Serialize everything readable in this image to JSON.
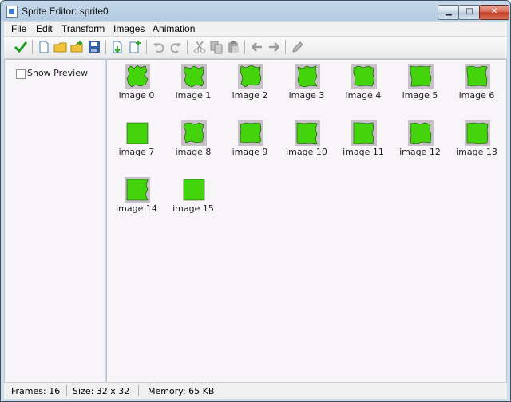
{
  "window": {
    "title": "Sprite Editor: sprite0",
    "controls": [
      "minimize-icon",
      "maximize-icon",
      "close-icon"
    ]
  },
  "menu": [
    {
      "accel": "F",
      "rest": "ile"
    },
    {
      "accel": "E",
      "rest": "dit"
    },
    {
      "accel": "T",
      "rest": "ransform"
    },
    {
      "accel": "I",
      "rest": "mages"
    },
    {
      "accel": "A",
      "rest": "nimation"
    }
  ],
  "toolbar": {
    "icons": [
      "confirm-check-icon",
      "new-file-icon",
      "open-folder-icon",
      "add-from-file-icon",
      "save-icon",
      "insert-image-icon",
      "add-image-icon",
      "undo-icon",
      "redo-icon",
      "cut-icon",
      "copy-icon",
      "paste-icon",
      "shift-left-icon",
      "shift-right-icon",
      "edit-pencil-icon"
    ]
  },
  "left": {
    "show_preview_label": "Show Preview",
    "show_preview_checked": false
  },
  "images": [
    {
      "label": "image 0"
    },
    {
      "label": "image 1"
    },
    {
      "label": "image 2"
    },
    {
      "label": "image 3"
    },
    {
      "label": "image 4"
    },
    {
      "label": "image 5"
    },
    {
      "label": "image 6"
    },
    {
      "label": "image 7"
    },
    {
      "label": "image 8"
    },
    {
      "label": "image 9"
    },
    {
      "label": "image 10"
    },
    {
      "label": "image 11"
    },
    {
      "label": "image 12"
    },
    {
      "label": "image 13"
    },
    {
      "label": "image 14"
    },
    {
      "label": "image 15"
    }
  ],
  "status": {
    "frames": "Frames: 16",
    "size": "Size: 32 x 32",
    "memory": "Memory: 65 KB"
  },
  "colors": {
    "sprite_green": "#44d40c",
    "pane_bg": "#f8f5f9"
  }
}
